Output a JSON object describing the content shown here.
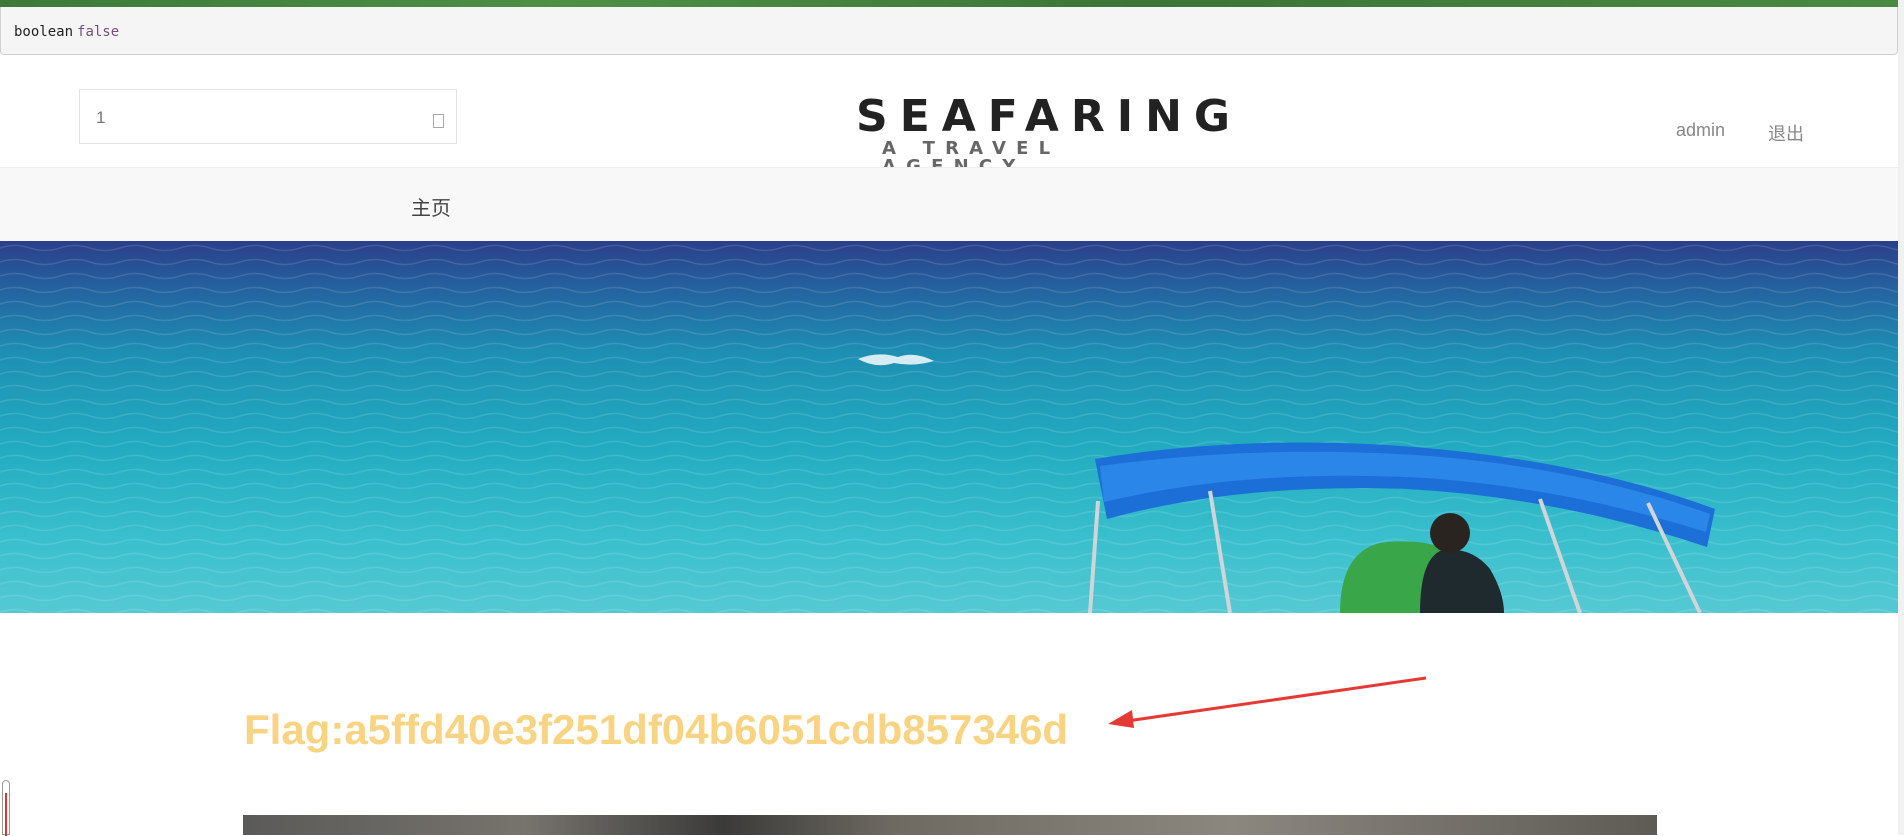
{
  "debug_output": {
    "type": "boolean",
    "value": "false"
  },
  "search": {
    "value": "1"
  },
  "logo": {
    "title": "SEAFARING",
    "subtitle": "A TRAVEL AGENCY"
  },
  "user_nav": {
    "username": "admin",
    "logout_label": "退出"
  },
  "nav": {
    "home_label": "主页"
  },
  "hero": {
    "description": "ocean with boat canopy"
  },
  "content": {
    "flag_text": "Flag:a5ffd40e3f251df04b6051cdb857346d"
  },
  "colors": {
    "flag": "#f7d382",
    "arrow": "#e53935",
    "sea": "#1fa3b8"
  }
}
